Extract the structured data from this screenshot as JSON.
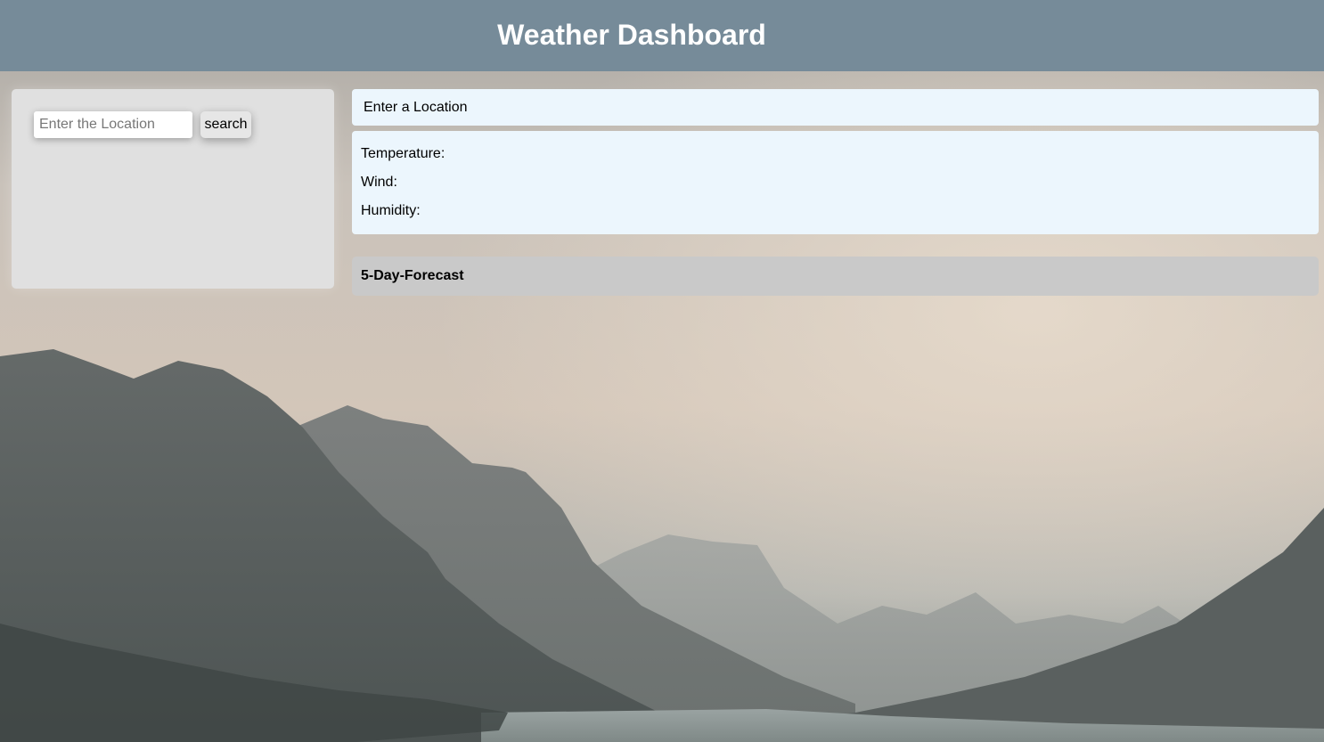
{
  "header": {
    "title": "Weather Dashboard"
  },
  "search": {
    "placeholder": "Enter the Location",
    "value": "",
    "button_label": "search"
  },
  "current": {
    "location_label": "Enter a Location",
    "temperature_label": "Temperature:",
    "wind_label": "Wind:",
    "humidity_label": "Humidity:"
  },
  "forecast": {
    "title": "5-Day-Forecast"
  },
  "colors": {
    "header_bg": "#768b99",
    "panel_bg": "#e0e0e0",
    "info_bg": "#ecf6fd",
    "forecast_bg": "#c9c9c9"
  },
  "background": {
    "scene": "mountain-lake-landscape"
  }
}
